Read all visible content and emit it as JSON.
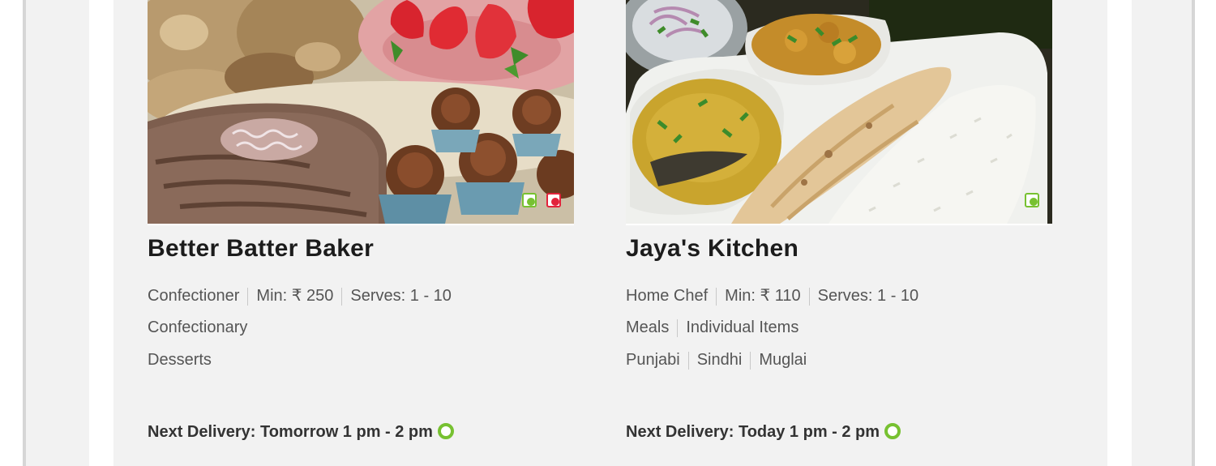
{
  "cards": [
    {
      "name": "Better Batter Baker",
      "chef_type": "Confectioner",
      "min_order": "Min: ₹ 250",
      "serves": "Serves: 1 - 10",
      "categories": [
        "Confectionary"
      ],
      "cuisines": [
        "Desserts"
      ],
      "delivery": "Next Delivery: Tomorrow 1 pm - 2 pm",
      "badges": [
        "veg",
        "non-veg"
      ],
      "photo": "desserts-photo"
    },
    {
      "name": "Jaya's Kitchen",
      "chef_type": "Home Chef",
      "min_order": "Min: ₹ 110",
      "serves": "Serves: 1 - 10",
      "categories": [
        "Meals",
        "Individual Items"
      ],
      "cuisines": [
        "Punjabi",
        "Sindhi",
        "Muglai"
      ],
      "delivery": "Next Delivery: Today 1 pm - 2 pm",
      "badges": [
        "veg"
      ],
      "photo": "thali-meal-photo"
    }
  ],
  "colors": {
    "veg": "#77c131",
    "non_veg": "#e2233b",
    "card_bg": "#f2f2f2"
  }
}
